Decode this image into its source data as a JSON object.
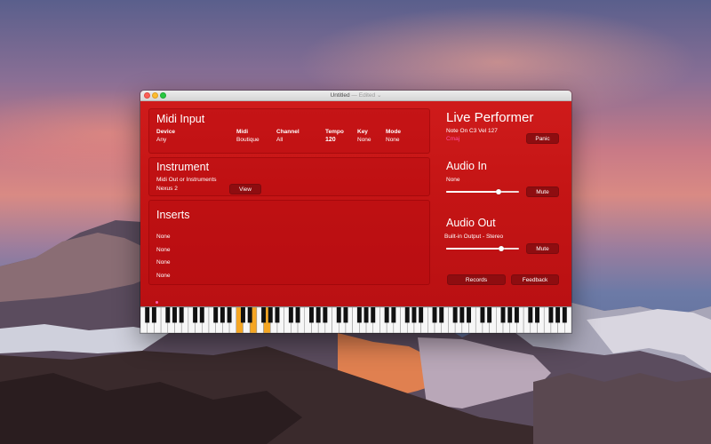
{
  "window": {
    "title": "Untitled",
    "title_suffix": "— Edited ⌄"
  },
  "midi_input": {
    "heading": "Midi Input",
    "columns": [
      {
        "label": "Device",
        "value": "Any"
      },
      {
        "label": "Midi",
        "value": "Boutique"
      },
      {
        "label": "Channel",
        "value": "All"
      },
      {
        "label": "Tempo",
        "value": "120"
      },
      {
        "label": "Key",
        "value": "None"
      },
      {
        "label": "Mode",
        "value": "None"
      }
    ]
  },
  "instrument": {
    "heading": "Instrument",
    "sub_label": "Midi Out or Instruments",
    "value": "Nexus 2",
    "view_button": "View"
  },
  "inserts": {
    "heading": "Inserts",
    "items": [
      "None",
      "None",
      "None",
      "None"
    ]
  },
  "live_performer": {
    "heading": "Live Performer",
    "note": "Note On C3 Vel 127",
    "chord": "Cmaj",
    "panic_button": "Panic"
  },
  "audio_in": {
    "heading": "Audio In",
    "device": "None",
    "level": 0.72,
    "mute_button": "Mute"
  },
  "audio_out": {
    "heading": "Audio Out",
    "device": "Built-in Output - Stereo",
    "level": 0.75,
    "mute_button": "Mute"
  },
  "footer_buttons": {
    "records": "Records",
    "feedback": "Feedback"
  },
  "keyboard": {
    "octaves": 9,
    "highlighted_white_keys": [
      14,
      16,
      18
    ],
    "highlight_color": "#f5a623"
  },
  "colors": {
    "accent_red": "#c51515",
    "button_dark": "#8e0d10",
    "chord_pink": "#ff4fa8"
  }
}
